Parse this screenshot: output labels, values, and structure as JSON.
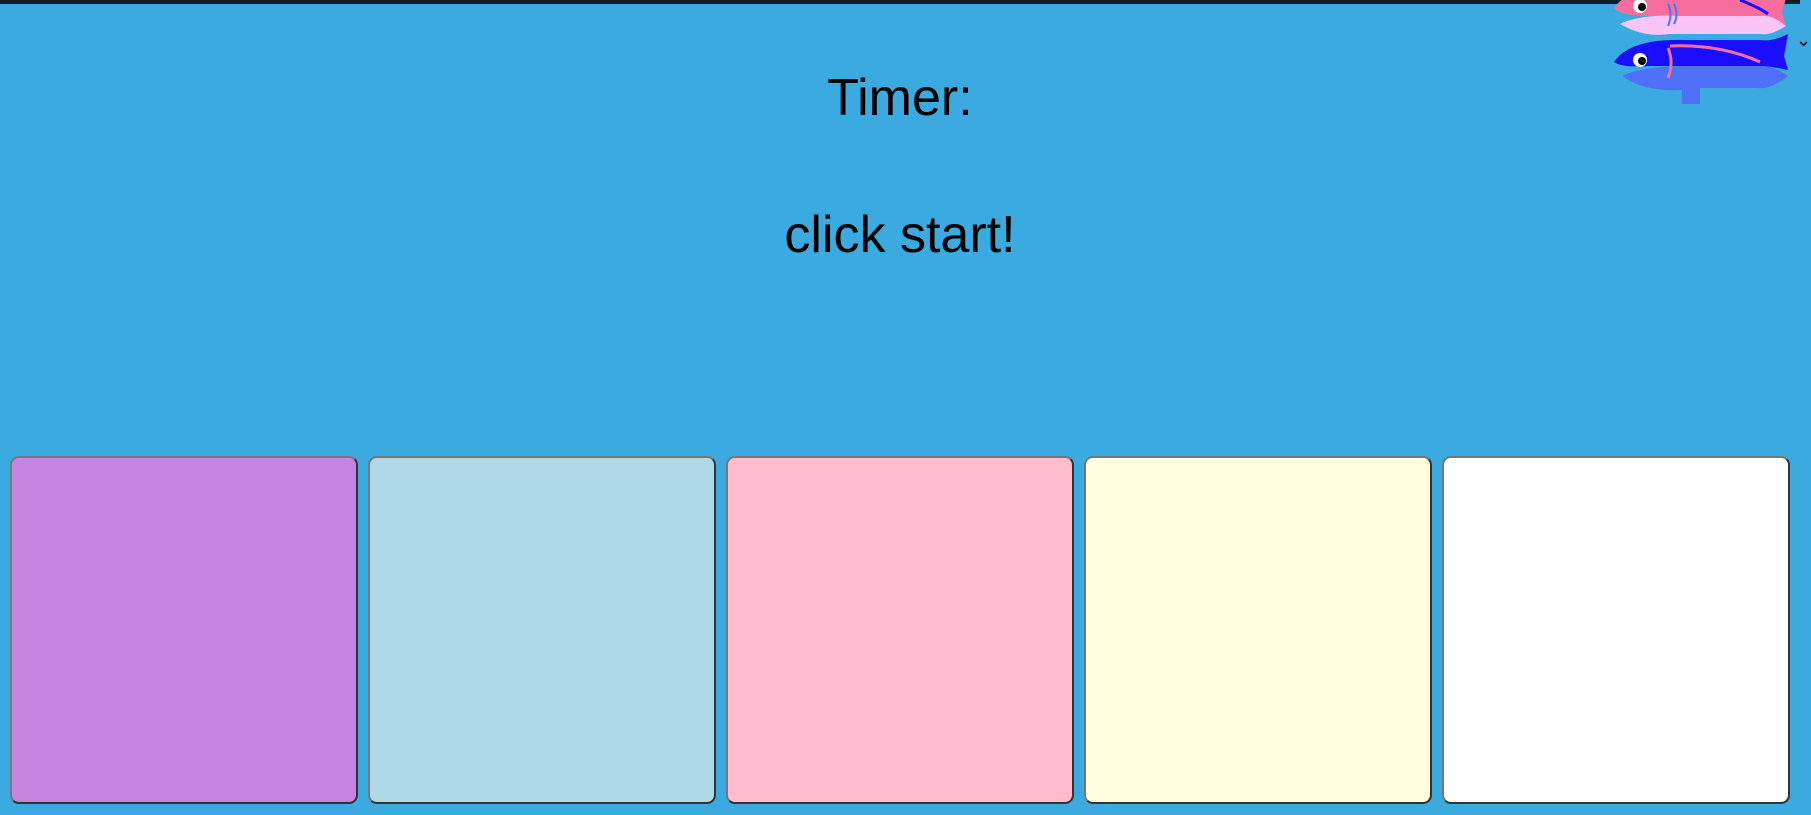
{
  "timer_label": "Timer:",
  "status_text": "click start!",
  "color_boxes": [
    {
      "name": "purple",
      "color": "#C584E0"
    },
    {
      "name": "light-blue",
      "color": "#ADD8E6"
    },
    {
      "name": "pink",
      "color": "#FFBCCD"
    },
    {
      "name": "light-yellow",
      "color": "#FFFEDE"
    },
    {
      "name": "white",
      "color": "#FFFFFF"
    }
  ],
  "fish_colors": {
    "pink_fish": "#F76E9E",
    "pink_fish_belly": "#FBC4F6",
    "blue_fish": "#1A0EFF",
    "blue_fish_belly": "#4F70F8"
  },
  "icons": {
    "fish_pair": "fish-icon",
    "dropdown": "chevron-down-icon"
  }
}
